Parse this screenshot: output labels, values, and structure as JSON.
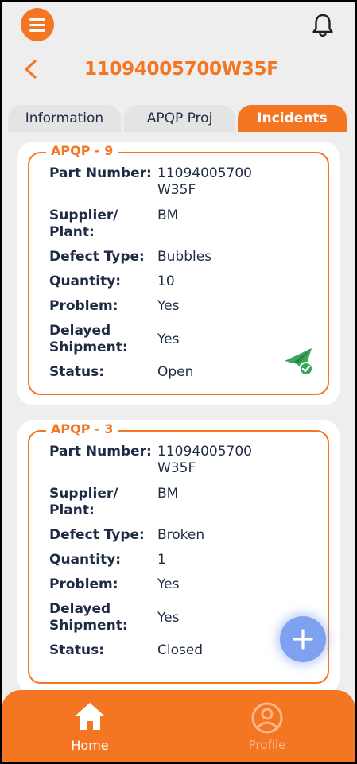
{
  "header": {
    "menu_icon": "hamburger-menu-icon",
    "bell_icon": "bell-icon",
    "back_icon": "chevron-left-icon",
    "title": "11094005700W35F"
  },
  "tabs": [
    {
      "label": "Information",
      "active": false
    },
    {
      "label": "APQP Proj",
      "active": false
    },
    {
      "label": "Incidents",
      "active": true
    }
  ],
  "incidents": [
    {
      "tag": "APQP - 9",
      "part_number_label": "Part Number:",
      "part_number_line1": "11094005700",
      "part_number_line2": "W35F",
      "supplier_label_line1": "Supplier/",
      "supplier_label_line2": "Plant:",
      "supplier": "BM",
      "defect_label": "Defect Type:",
      "defect": "Bubbles",
      "quantity_label": "Quantity:",
      "quantity": "10",
      "problem_label": "Problem:",
      "problem": "Yes",
      "delayed_label_line1": "Delayed",
      "delayed_label_line2": "Shipment:",
      "delayed": "Yes",
      "status_label": "Status:",
      "status": "Open",
      "status_icon": "sent-check-icon"
    },
    {
      "tag": "APQP - 3",
      "part_number_label": "Part Number:",
      "part_number_line1": "11094005700",
      "part_number_line2": "W35F",
      "supplier_label_line1": "Supplier/",
      "supplier_label_line2": "Plant:",
      "supplier": "BM",
      "defect_label": "Defect Type:",
      "defect": "Broken",
      "quantity_label": "Quantity:",
      "quantity": "1",
      "problem_label": "Problem:",
      "problem": "Yes",
      "delayed_label_line1": "Delayed",
      "delayed_label_line2": "Shipment:",
      "delayed": "Yes",
      "status_label": "Status:",
      "status": "Closed"
    }
  ],
  "fab": {
    "icon": "plus-icon"
  },
  "bottom_nav": [
    {
      "label": "Home",
      "icon": "home-icon",
      "active": true
    },
    {
      "label": "Profile",
      "icon": "profile-icon",
      "active": false
    }
  ],
  "colors": {
    "accent": "#f47622",
    "text_dark": "#1f2a44",
    "background": "#eeeeee",
    "success_green": "#3aa65a",
    "fab_blue": "#7ea2f0"
  }
}
